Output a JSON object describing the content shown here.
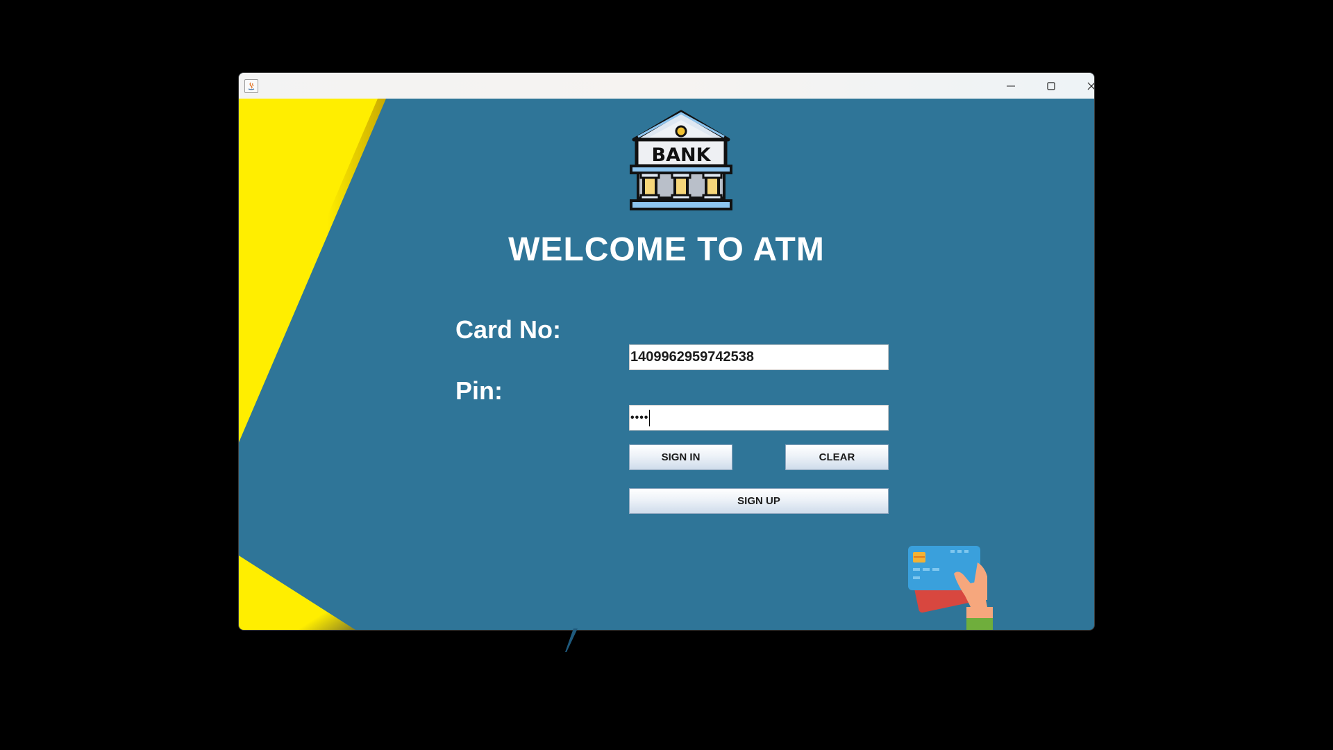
{
  "window": {
    "title": "",
    "controls": {
      "minimize_icon": "minimize-icon",
      "maximize_icon": "maximize-icon",
      "close_icon": "close-icon"
    }
  },
  "logo": {
    "text": "BANK",
    "icon": "bank-building-icon"
  },
  "heading": "WELCOME TO ATM",
  "form": {
    "card_label": "Card No:",
    "card_value": "1409962959742538",
    "pin_label": "Pin:",
    "pin_value": "••••"
  },
  "buttons": {
    "sign_in": "SIGN IN",
    "clear": "CLEAR",
    "sign_up": "SIGN UP"
  },
  "colors": {
    "background": "#2f7598",
    "accent_yellow": "#ffee00"
  }
}
